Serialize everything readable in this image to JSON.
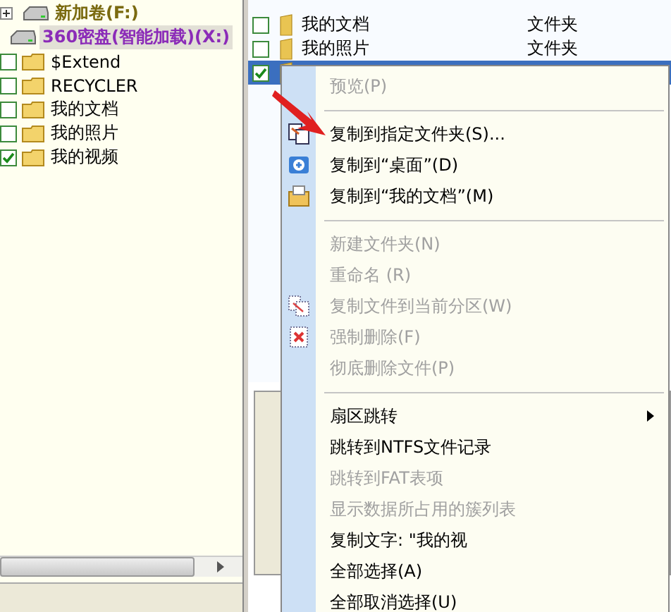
{
  "tree": [
    {
      "label": "新加卷(F:)",
      "expanded": false,
      "selected": false,
      "color": "#7a6a10"
    },
    {
      "label": "360密盘(智能加载)(X:)",
      "expanded": true,
      "selected": true,
      "color": "#8b2bb8",
      "children": [
        {
          "label": "$Extend",
          "checked": false
        },
        {
          "label": "RECYCLER",
          "checked": false
        },
        {
          "label": "我的文档",
          "checked": false
        },
        {
          "label": "我的照片",
          "checked": false
        },
        {
          "label": "我的视频",
          "checked": true
        }
      ]
    }
  ],
  "files": [
    {
      "name": "我的文档",
      "type": "文件夹",
      "checked": false,
      "selected": false
    },
    {
      "name": "我的照片",
      "type": "文件夹",
      "checked": false,
      "selected": false
    },
    {
      "checked": true,
      "selected": true
    }
  ],
  "context_menu": [
    {
      "kind": "item",
      "label": "预览(P)",
      "disabled": true
    },
    {
      "kind": "separator"
    },
    {
      "kind": "item",
      "label": "复制到指定文件夹(S)...",
      "disabled": false
    },
    {
      "kind": "item",
      "label": "复制到“桌面”(D)",
      "disabled": false
    },
    {
      "kind": "item",
      "label": "复制到“我的文档”(M)",
      "disabled": false
    },
    {
      "kind": "separator"
    },
    {
      "kind": "item",
      "label": "新建文件夹(N)",
      "disabled": true
    },
    {
      "kind": "item",
      "label": "重命名 (R)",
      "disabled": true
    },
    {
      "kind": "item",
      "label": "复制文件到当前分区(W)",
      "disabled": true
    },
    {
      "kind": "item",
      "label": "强制删除(F)",
      "disabled": true
    },
    {
      "kind": "item",
      "label": "彻底删除文件(P)",
      "disabled": true
    },
    {
      "kind": "separator"
    },
    {
      "kind": "submenu",
      "label": "扇区跳转",
      "disabled": false
    },
    {
      "kind": "item",
      "label": "跳转到NTFS文件记录",
      "disabled": false
    },
    {
      "kind": "item",
      "label": "跳转到FAT表项",
      "disabled": true
    },
    {
      "kind": "item",
      "label": "显示数据所占用的簇列表",
      "disabled": true
    },
    {
      "kind": "item",
      "label": "复制文字: \"我的视",
      "disabled": false
    },
    {
      "kind": "item",
      "label": "全部选择(A)",
      "disabled": false
    },
    {
      "kind": "item",
      "label": "全部取消选择(U)",
      "disabled": false
    }
  ]
}
